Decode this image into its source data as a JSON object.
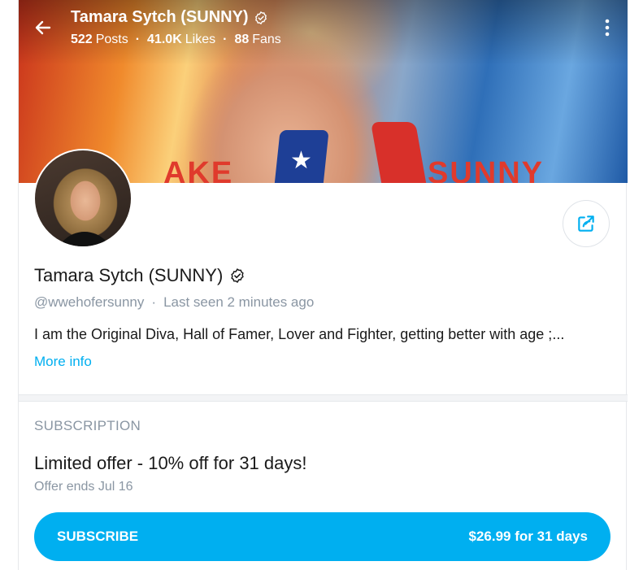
{
  "header": {
    "title": "Tamara Sytch (SUNNY)",
    "stats": [
      {
        "value": "522",
        "label": "Posts"
      },
      {
        "value": "41.0K",
        "label": "Likes"
      },
      {
        "value": "88",
        "label": "Fans"
      }
    ],
    "separator": "·"
  },
  "banner": {
    "word_left": "AKE",
    "word_right": "SUNNY",
    "star": "★"
  },
  "profile": {
    "name": "Tamara Sytch (SUNNY)",
    "handle": "@wwehofersunny",
    "separator": "·",
    "last_seen": "Last seen 2 minutes ago",
    "bio": "I am the Original Diva, Hall of Famer, Lover and Fighter, getting better with age ;...",
    "more_info": "More info"
  },
  "subscription": {
    "heading": "SUBSCRIPTION",
    "offer_title": "Limited offer - 10% off for 31 days!",
    "offer_ends": "Offer ends Jul 16",
    "button_label": "SUBSCRIBE",
    "button_price": "$26.99 for 31 days"
  },
  "colors": {
    "accent": "#00aff0",
    "muted_text": "#8a96a3"
  },
  "icons": [
    "back-arrow-icon",
    "verified-icon",
    "more-vertical-icon",
    "share-icon"
  ]
}
